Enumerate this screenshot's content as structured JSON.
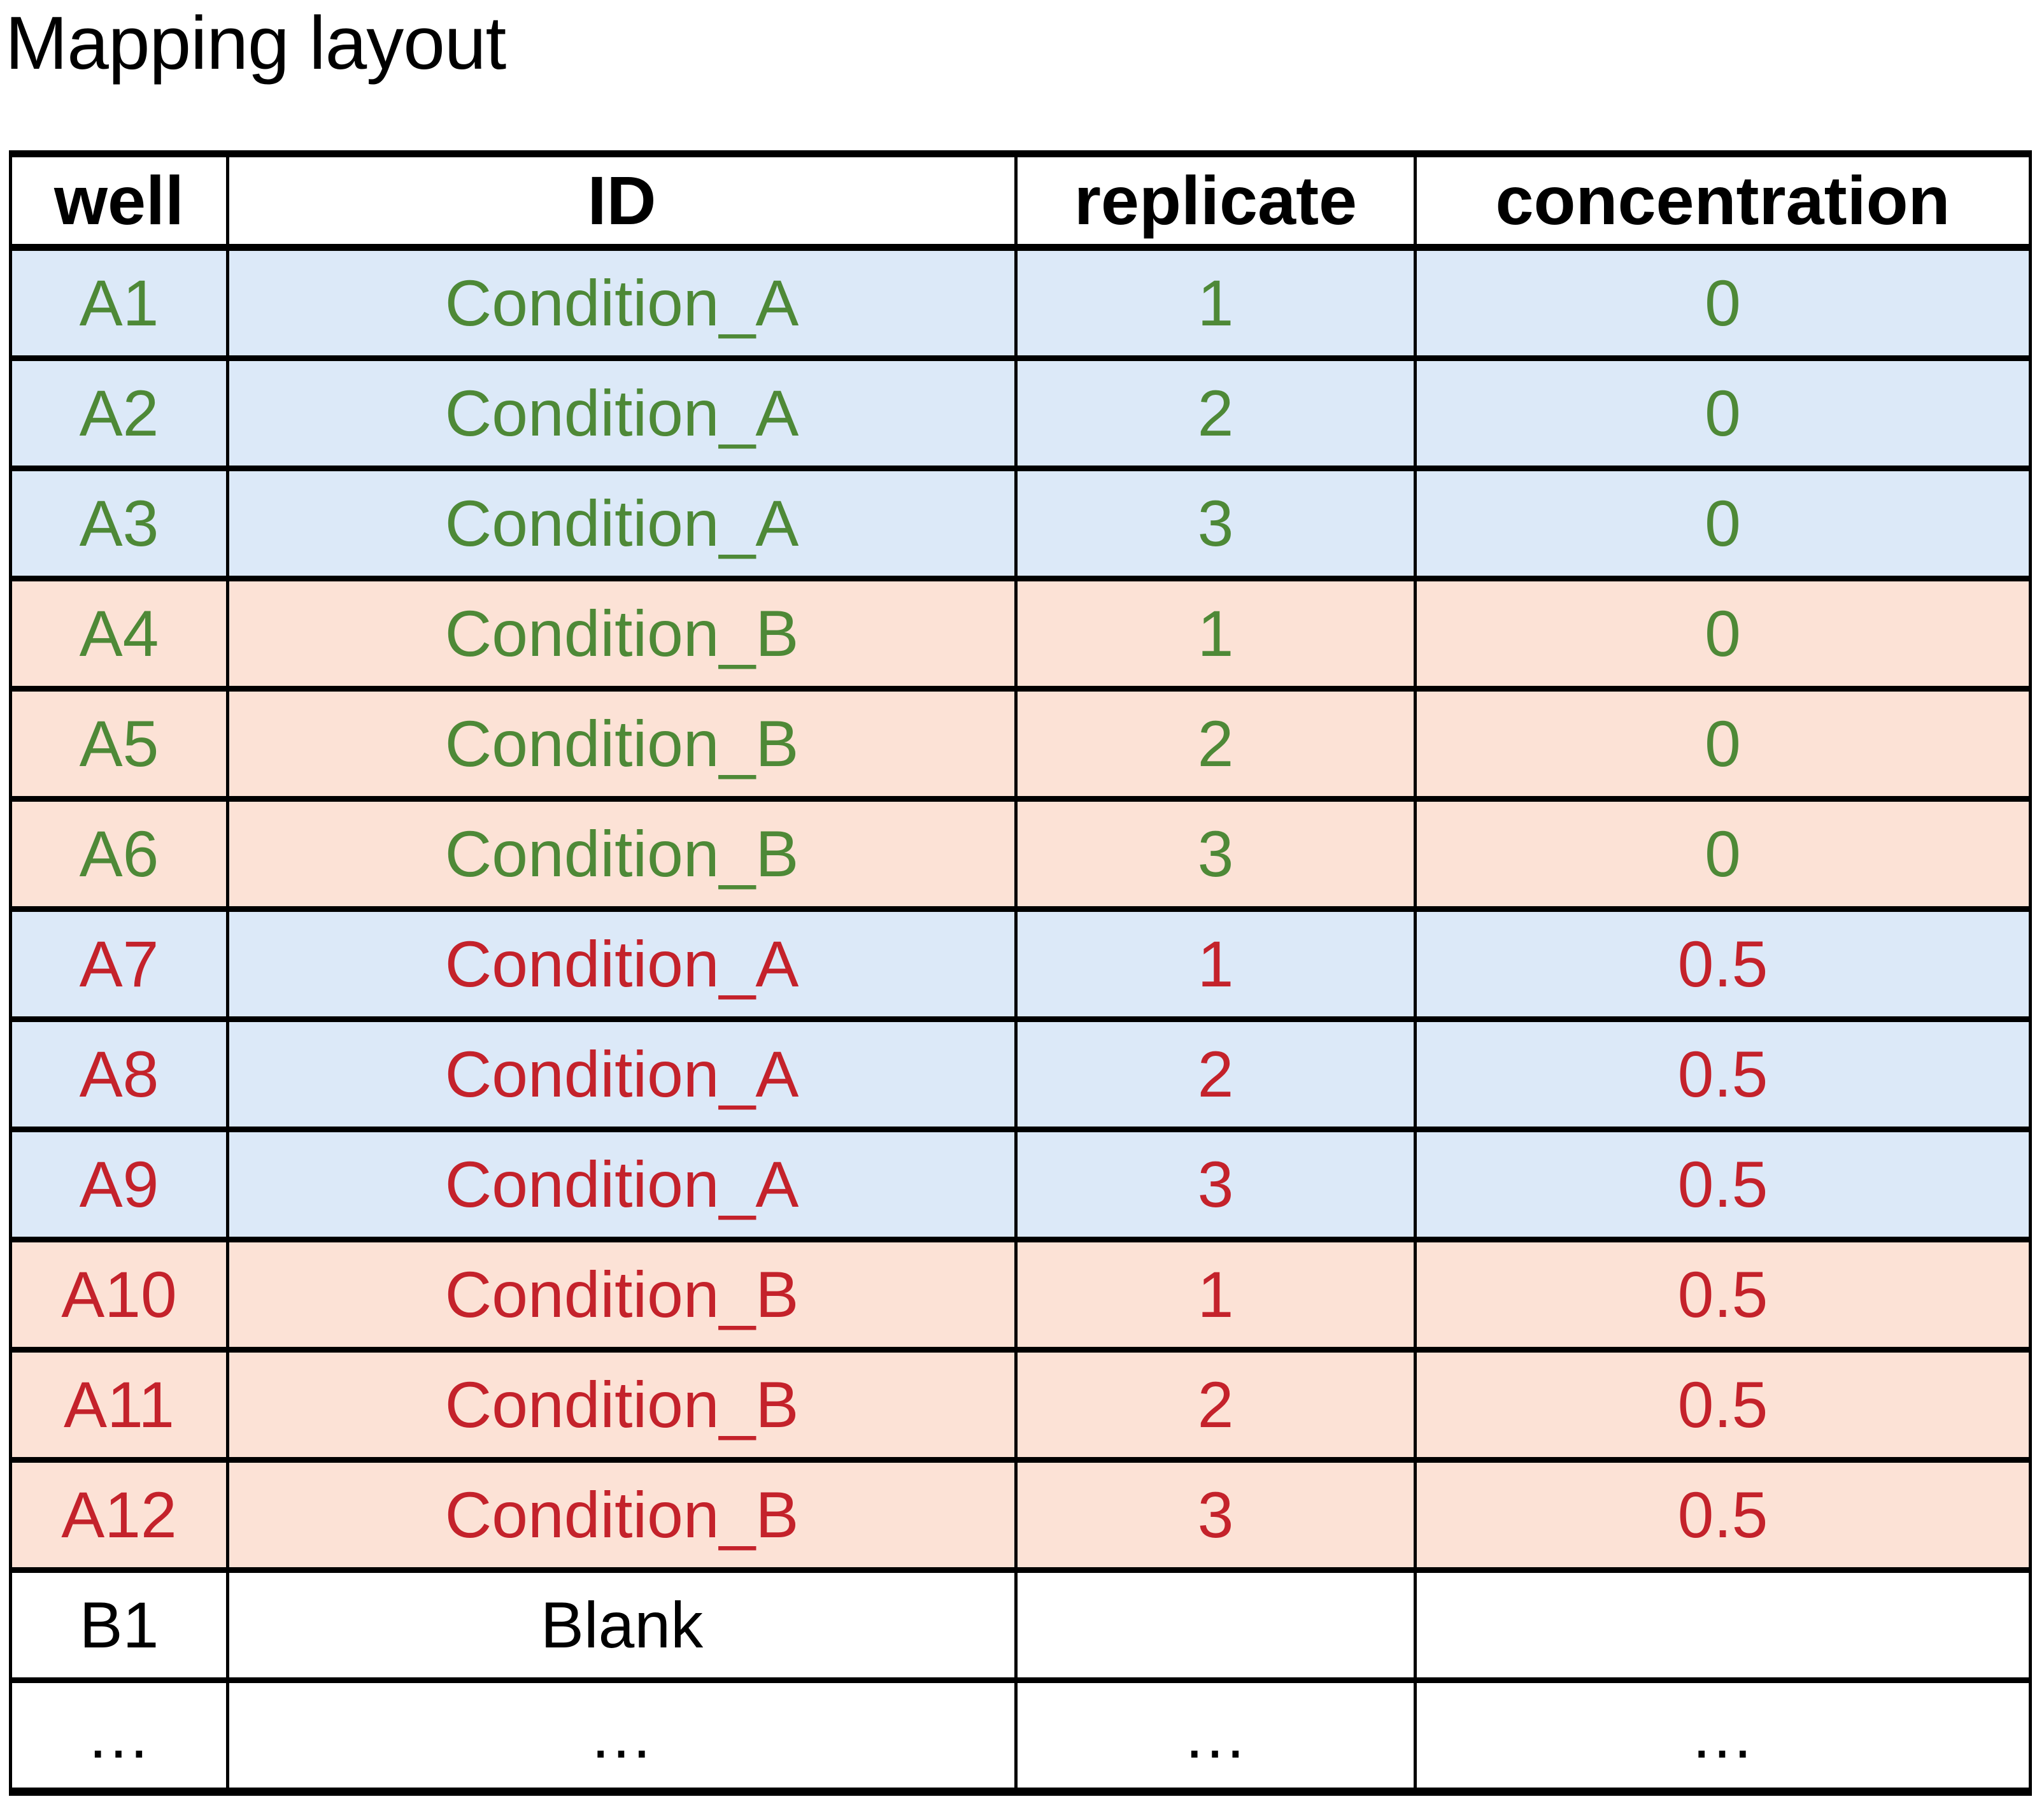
{
  "page": {
    "title": "Mapping layout"
  },
  "colors": {
    "row_blue": "#dce9f8",
    "row_orange": "#fce2d6",
    "row_white": "#ffffff",
    "text_green": "#4e8937",
    "text_red": "#c4222b",
    "text_black": "#000000",
    "border": "#000000"
  },
  "table": {
    "columns": [
      {
        "key": "well",
        "label": "well"
      },
      {
        "key": "id",
        "label": "ID"
      },
      {
        "key": "replicate",
        "label": "replicate"
      },
      {
        "key": "concentration",
        "label": "concentration"
      }
    ],
    "rows": [
      {
        "well": "A1",
        "id": "Condition_A",
        "replicate": "1",
        "concentration": "0",
        "bg": "blue",
        "fg": "green"
      },
      {
        "well": "A2",
        "id": "Condition_A",
        "replicate": "2",
        "concentration": "0",
        "bg": "blue",
        "fg": "green"
      },
      {
        "well": "A3",
        "id": "Condition_A",
        "replicate": "3",
        "concentration": "0",
        "bg": "blue",
        "fg": "green"
      },
      {
        "well": "A4",
        "id": "Condition_B",
        "replicate": "1",
        "concentration": "0",
        "bg": "orange",
        "fg": "green"
      },
      {
        "well": "A5",
        "id": "Condition_B",
        "replicate": "2",
        "concentration": "0",
        "bg": "orange",
        "fg": "green"
      },
      {
        "well": "A6",
        "id": "Condition_B",
        "replicate": "3",
        "concentration": "0",
        "bg": "orange",
        "fg": "green"
      },
      {
        "well": "A7",
        "id": "Condition_A",
        "replicate": "1",
        "concentration": "0.5",
        "bg": "blue",
        "fg": "red"
      },
      {
        "well": "A8",
        "id": "Condition_A",
        "replicate": "2",
        "concentration": "0.5",
        "bg": "blue",
        "fg": "red"
      },
      {
        "well": "A9",
        "id": "Condition_A",
        "replicate": "3",
        "concentration": "0.5",
        "bg": "blue",
        "fg": "red"
      },
      {
        "well": "A10",
        "id": "Condition_B",
        "replicate": "1",
        "concentration": "0.5",
        "bg": "orange",
        "fg": "red"
      },
      {
        "well": "A11",
        "id": "Condition_B",
        "replicate": "2",
        "concentration": "0.5",
        "bg": "orange",
        "fg": "red"
      },
      {
        "well": "A12",
        "id": "Condition_B",
        "replicate": "3",
        "concentration": "0.5",
        "bg": "orange",
        "fg": "red"
      },
      {
        "well": "B1",
        "id": "Blank",
        "replicate": "",
        "concentration": "",
        "bg": "white",
        "fg": "black"
      },
      {
        "well": "…",
        "id": "…",
        "replicate": "…",
        "concentration": "…",
        "bg": "white",
        "fg": "black"
      }
    ]
  }
}
